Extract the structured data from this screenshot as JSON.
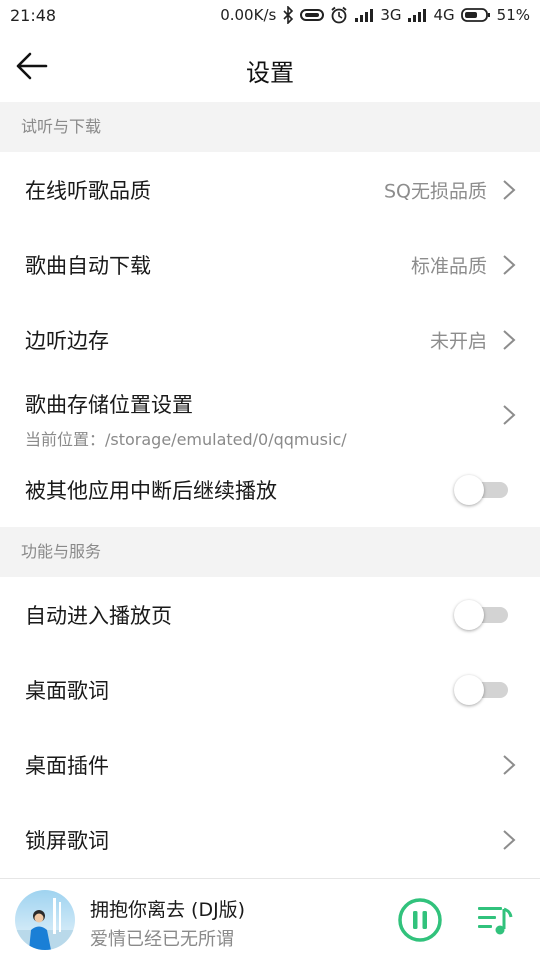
{
  "status_bar": {
    "time": "21:48",
    "speed": "0.00K/s",
    "net1": "3G",
    "net2": "4G",
    "battery": "51%"
  },
  "nav": {
    "title": "设置",
    "back_icon": "back-arrow-icon"
  },
  "sections": [
    {
      "header": "试听与下载",
      "rows": [
        {
          "label": "在线听歌品质",
          "value": "SQ无损品质",
          "type": "link"
        },
        {
          "label": "歌曲自动下载",
          "value": "标准品质",
          "type": "link"
        },
        {
          "label": "边听边存",
          "value": "未开启",
          "type": "link"
        },
        {
          "label": "歌曲存储位置设置",
          "sub": "当前位置：/storage/emulated/0/qqmusic/",
          "type": "link"
        },
        {
          "label": "被其他应用中断后继续播放",
          "type": "toggle",
          "on": false
        }
      ]
    },
    {
      "header": "功能与服务",
      "rows": [
        {
          "label": "自动进入播放页",
          "type": "toggle",
          "on": false
        },
        {
          "label": "桌面歌词",
          "type": "toggle",
          "on": false
        },
        {
          "label": "桌面插件",
          "type": "link"
        },
        {
          "label": "锁屏歌词",
          "type": "link"
        }
      ]
    }
  ],
  "player": {
    "title": "拥抱你离去 (DJ版)",
    "subtitle": "爱情已经已无所谓",
    "accent_color": "#31c27c",
    "state": "playing"
  }
}
